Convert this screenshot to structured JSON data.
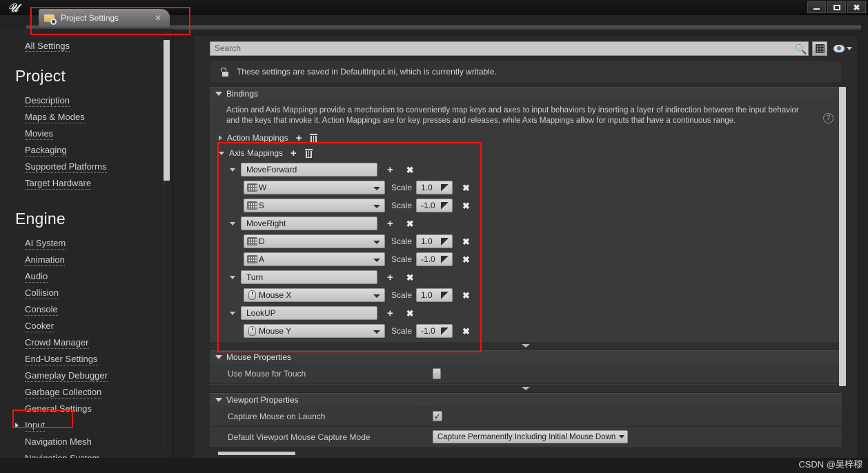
{
  "window": {
    "logo": "unreal-logo",
    "minimize": "–",
    "maximize": "□",
    "close": "✕"
  },
  "tab": {
    "label": "Project Settings",
    "close": "✕"
  },
  "sidebar": {
    "all_settings": "All Settings",
    "groups": [
      {
        "title": "Project",
        "items": [
          {
            "label": "Description",
            "expandable": false,
            "selected": false
          },
          {
            "label": "Maps & Modes",
            "expandable": false,
            "selected": false
          },
          {
            "label": "Movies",
            "expandable": false,
            "selected": false
          },
          {
            "label": "Packaging",
            "expandable": false,
            "selected": false
          },
          {
            "label": "Supported Platforms",
            "expandable": false,
            "selected": false
          },
          {
            "label": "Target Hardware",
            "expandable": false,
            "selected": false
          }
        ]
      },
      {
        "title": "Engine",
        "items": [
          {
            "label": "AI System",
            "expandable": false,
            "selected": false
          },
          {
            "label": "Animation",
            "expandable": false,
            "selected": false
          },
          {
            "label": "Audio",
            "expandable": false,
            "selected": false
          },
          {
            "label": "Collision",
            "expandable": false,
            "selected": false
          },
          {
            "label": "Console",
            "expandable": false,
            "selected": false
          },
          {
            "label": "Cooker",
            "expandable": false,
            "selected": false
          },
          {
            "label": "Crowd Manager",
            "expandable": false,
            "selected": false
          },
          {
            "label": "End-User Settings",
            "expandable": false,
            "selected": false
          },
          {
            "label": "Gameplay Debugger",
            "expandable": false,
            "selected": false
          },
          {
            "label": "Garbage Collection",
            "expandable": false,
            "selected": false
          },
          {
            "label": "General Settings",
            "expandable": false,
            "selected": false
          },
          {
            "label": "Input",
            "expandable": true,
            "selected": true
          },
          {
            "label": "Navigation Mesh",
            "expandable": false,
            "selected": false
          },
          {
            "label": "Navigation System",
            "expandable": false,
            "selected": false
          }
        ]
      }
    ]
  },
  "toolbar": {
    "search_placeholder": "Search",
    "search_value": "",
    "search_icon": "magnifier-icon",
    "grid_view_icon": "grid-view-icon",
    "visibility_icon": "eye-icon"
  },
  "info": {
    "icon": "unlocked-padlock-icon",
    "text": "These settings are saved in DefaultInput.ini, which is currently writable."
  },
  "bindings": {
    "title": "Bindings",
    "description": "Action and Axis Mappings provide a mechanism to conveniently map keys and axes to input behaviors by inserting a layer of indirection between the input behavior and the keys that invoke it. Action Mappings are for key presses and releases, while Axis Mappings allow for inputs that have a continuous range.",
    "help_icon": "?",
    "action_mappings": {
      "label": "Action Mappings",
      "expanded": false,
      "add_icon": "+",
      "delete_icon": "trash-icon"
    },
    "axis_mappings": {
      "label": "Axis Mappings",
      "expanded": true,
      "add_icon": "+",
      "delete_icon": "trash-icon",
      "scale_label": "Scale",
      "entries": [
        {
          "name": "MoveForward",
          "keys": [
            {
              "key": "W",
              "device": "keyboard",
              "scale": "1.0"
            },
            {
              "key": "S",
              "device": "keyboard",
              "scale": "-1.0"
            }
          ]
        },
        {
          "name": "MoveRight",
          "keys": [
            {
              "key": "D",
              "device": "keyboard",
              "scale": "1.0"
            },
            {
              "key": "A",
              "device": "keyboard",
              "scale": "-1.0"
            }
          ]
        },
        {
          "name": "Turn",
          "keys": [
            {
              "key": "Mouse X",
              "device": "mouse",
              "scale": "1.0"
            }
          ]
        },
        {
          "name": "LookUP",
          "keys": [
            {
              "key": "Mouse Y",
              "device": "mouse",
              "scale": "-1.0"
            }
          ]
        }
      ]
    }
  },
  "mouse_properties": {
    "title": "Mouse Properties",
    "rows": [
      {
        "name": "Use Mouse for Touch",
        "type": "checkbox",
        "checked": false,
        "value": ""
      }
    ]
  },
  "viewport_properties": {
    "title": "Viewport Properties",
    "rows": [
      {
        "name": "Capture Mouse on Launch",
        "type": "checkbox",
        "checked": true,
        "value": "✓"
      },
      {
        "name": "Default Viewport Mouse Capture Mode",
        "type": "combo",
        "value": "Capture Permanently Including Initial Mouse Down"
      }
    ]
  },
  "watermark": "CSDN @吴梓穆",
  "colors": {
    "highlight": "#ef1414",
    "panel_bg": "#2b2b2b",
    "section_bg": "#3c3c3c",
    "sidebar_bg": "#262626",
    "field_bg": "#c8c8c8"
  }
}
